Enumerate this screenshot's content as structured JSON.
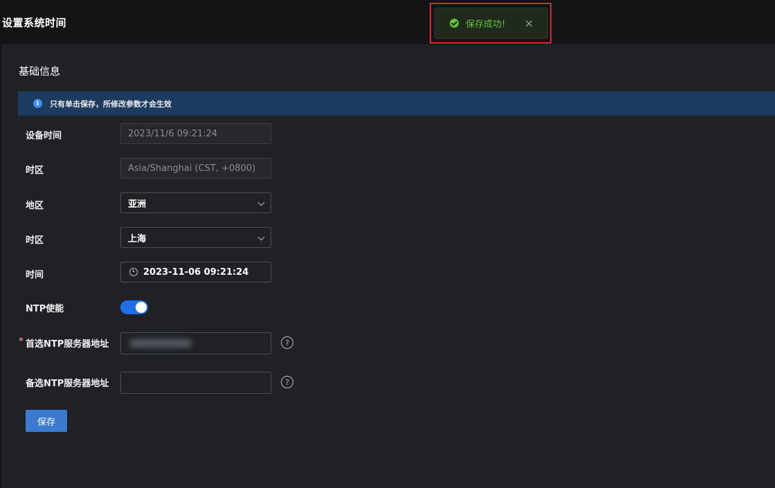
{
  "page": {
    "title": "设置系统时间"
  },
  "toast": {
    "message": "保存成功!",
    "close_glyph": "×",
    "icon": "success-check-icon"
  },
  "section": {
    "title": "基础信息"
  },
  "notice": {
    "icon": "info-icon",
    "glyph": "i",
    "text": "只有单击保存，所修改参数才会生效"
  },
  "form": {
    "device_time": {
      "label": "设备时间",
      "value": "2023/11/6 09:21:24"
    },
    "timezone_display": {
      "label": "时区",
      "value": "Asia/Shanghai (CST, +0800)"
    },
    "region": {
      "label": "地区",
      "value": "亚洲"
    },
    "timezone_select": {
      "label": "时区",
      "value": "上海"
    },
    "time": {
      "label": "时间",
      "value": "2023-11-06 09:21:24"
    },
    "ntp_enable": {
      "label": "NTP使能",
      "enabled": true
    },
    "primary_ntp": {
      "required_mark": "*",
      "label": "首选NTP服务器地址",
      "value": "",
      "help": "?"
    },
    "secondary_ntp": {
      "label": "备选NTP服务器地址",
      "value": "",
      "help": "?"
    }
  },
  "actions": {
    "save_label": "保存"
  },
  "colors": {
    "accent": "#3a7bd0",
    "success": "#67c23a",
    "toggle_on": "#1f6feb",
    "highlight": "#e0262b"
  }
}
